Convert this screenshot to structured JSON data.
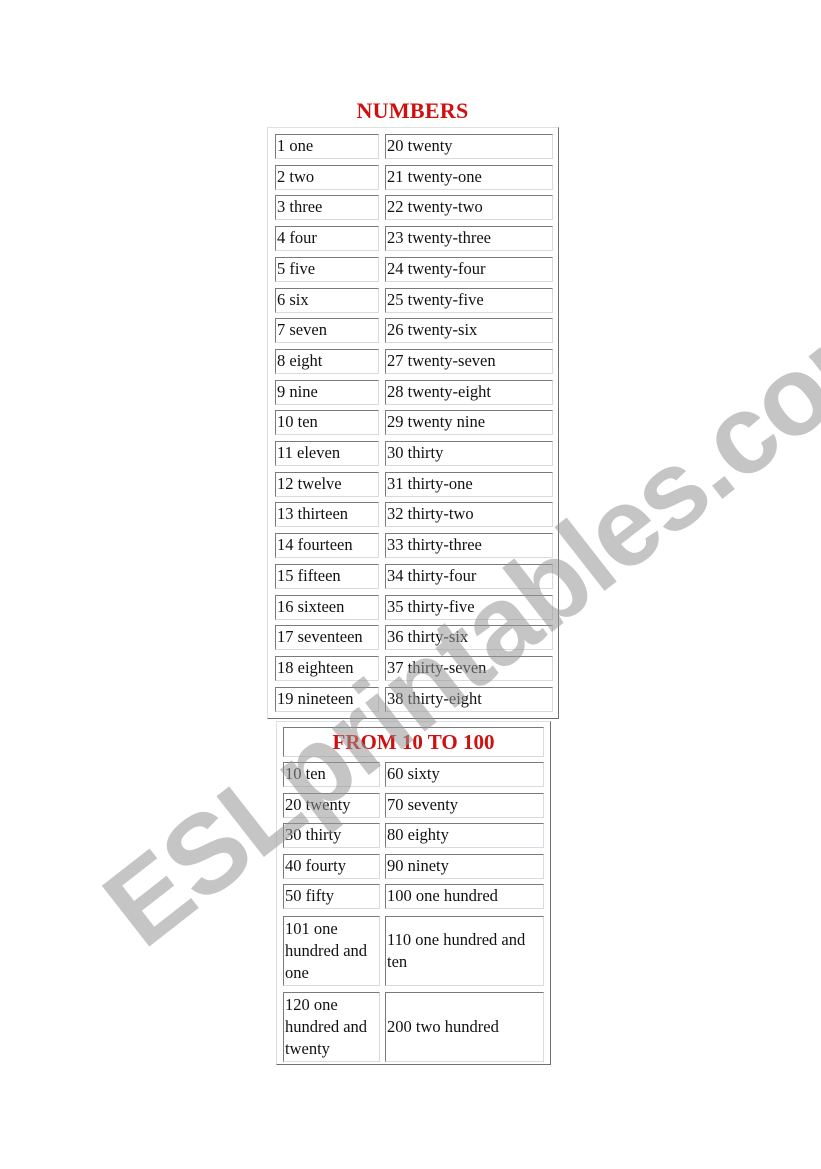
{
  "title": "NUMBERS",
  "table1": {
    "left": [
      "1 one",
      "2 two",
      "3 three",
      "4 four",
      "5 five",
      "6 six",
      "7 seven",
      "8 eight",
      "9 nine",
      "10 ten",
      "11 eleven",
      "12 twelve",
      "13 thirteen",
      "14 fourteen",
      "15 fifteen",
      "16 sixteen",
      "17 seventeen",
      "18 eighteen",
      "19 nineteen"
    ],
    "right": [
      "20 twenty",
      "21 twenty-one",
      "22 twenty-two",
      "23 twenty-three",
      "24 twenty-four",
      "25 twenty-five",
      "26 twenty-six",
      "27 twenty-seven",
      "28 twenty-eight",
      "29 twenty nine",
      "30 thirty",
      "31 thirty-one",
      "32 thirty-two",
      "33 thirty-three",
      "34 thirty-four",
      "35 thirty-five",
      "36 thirty-six",
      "37 thirty-seven",
      "38 thirty-eight"
    ]
  },
  "table2": {
    "heading": "FROM 10 TO 100",
    "rows": [
      [
        "10 ten",
        "60 sixty"
      ],
      [
        "20 twenty",
        "70 seventy"
      ],
      [
        "30 thirty",
        "80 eighty"
      ],
      [
        "40 fourty",
        "90 ninety"
      ],
      [
        "50 fifty",
        "100 one hundred"
      ],
      [
        "101 one hundred and one",
        "110 one hundred and ten"
      ],
      [
        "120 one hundred and twenty",
        "200 two hundred"
      ]
    ]
  },
  "watermark": "ESLprintables.com",
  "colors": {
    "heading": "#d01010"
  }
}
